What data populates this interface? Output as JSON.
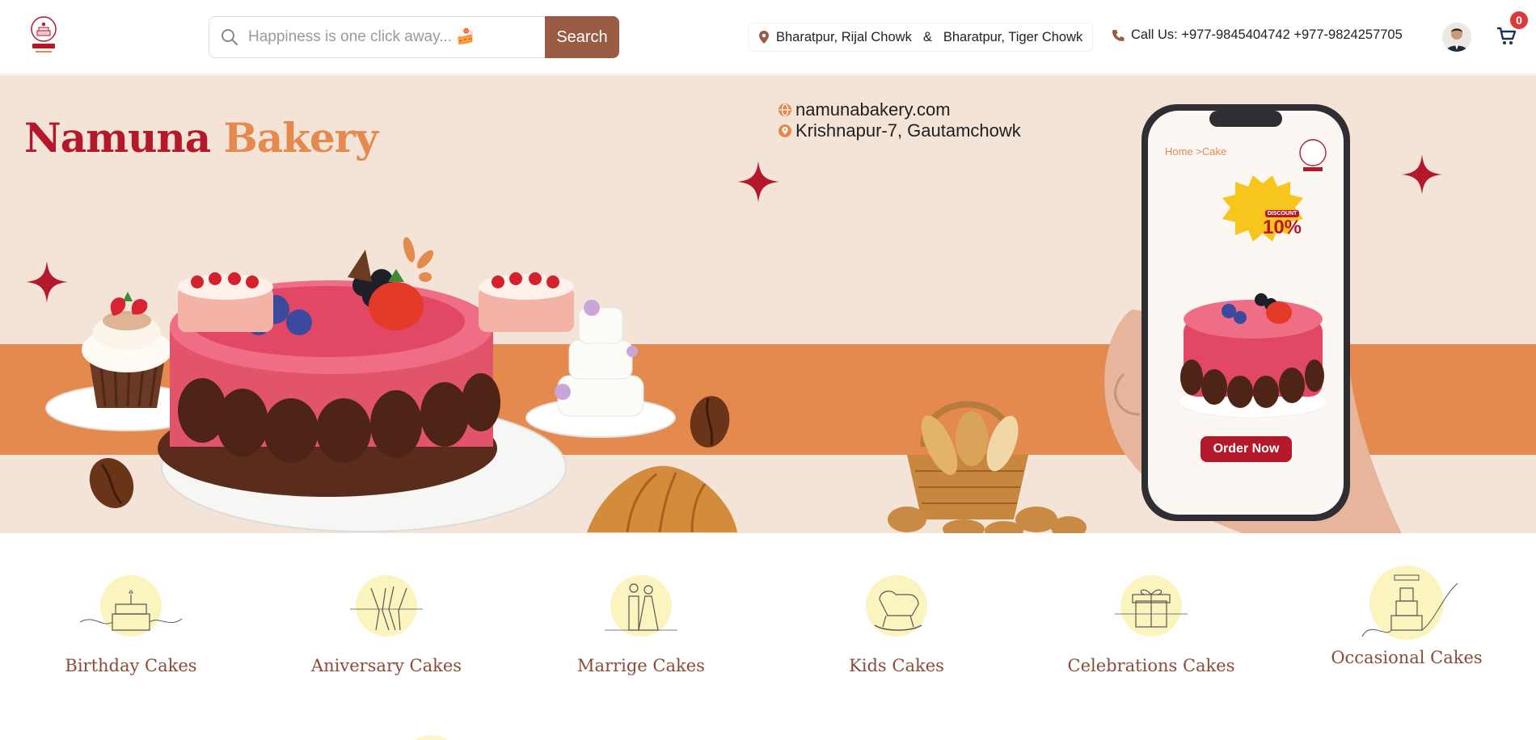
{
  "header": {
    "logo_icon": "namuna-bakery-logo",
    "search": {
      "placeholder": "Happiness is one click away... 🍰",
      "value": "",
      "button_label": "Search",
      "icon": "search-icon"
    },
    "locations": {
      "first": "Bharatpur, Rijal Chowk",
      "separator": "&",
      "second": "Bharatpur, Tiger Chowk",
      "icon": "location-pin-icon"
    },
    "call": {
      "label": "Call Us: +977-9845404742 +977-9824257705",
      "icon": "phone-icon"
    },
    "avatar_icon": "user-avatar",
    "cart": {
      "icon": "cart-icon",
      "count": "0"
    }
  },
  "banner": {
    "brand_first": "Namuna",
    "brand_second": "Bakery",
    "website": "namunabakery.com",
    "address": "Krishnapur-7, Gautamchowk",
    "phone_screen": {
      "breadcrumb": "Home >Cake",
      "discount_small": "DISCOUNT",
      "discount_big": "10%",
      "order_button": "Order Now"
    },
    "colors": {
      "primary_red": "#b3192a",
      "accent_orange": "#e58a4f",
      "background": "#f4e3d7"
    }
  },
  "categories": [
    {
      "label": "Birthday Cakes",
      "icon": "birthday-cake-icon"
    },
    {
      "label": "Aniversary Cakes",
      "icon": "champagne-glasses-icon"
    },
    {
      "label": "Marrige Cakes",
      "icon": "wedding-couple-icon"
    },
    {
      "label": "Kids Cakes",
      "icon": "rocking-horse-icon"
    },
    {
      "label": "Celebrations Cakes",
      "icon": "gift-box-icon"
    },
    {
      "label": "Occasional Cakes",
      "icon": "tiered-cake-icon"
    }
  ],
  "theme": {
    "button_brown": "#9a5b45",
    "category_text": "#8a4b38",
    "badge_red": "#d93a3a"
  }
}
